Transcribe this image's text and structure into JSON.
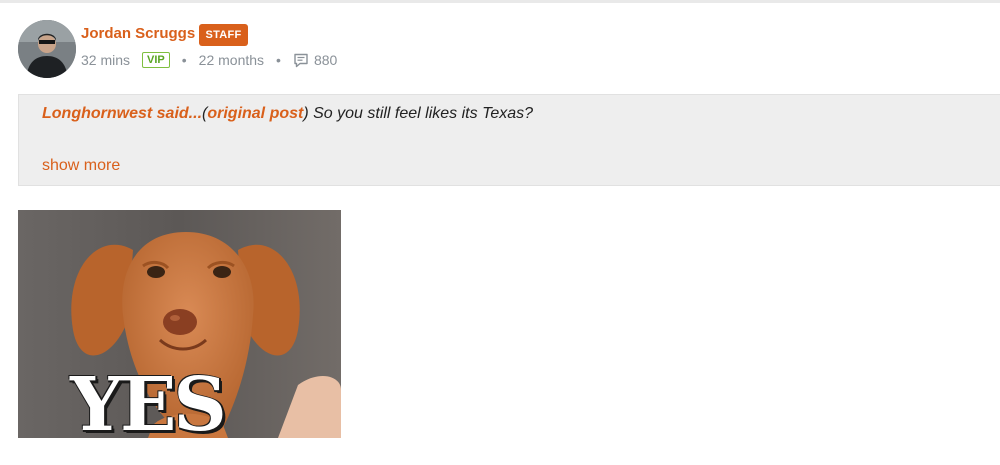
{
  "post": {
    "author": "Jordan Scruggs",
    "role_badge": "STAFF",
    "time_ago": "32 mins",
    "membership_badge": "VIP",
    "member_tenure": "22 months",
    "comment_count": "880",
    "colors": {
      "accent": "#d9601b",
      "vip": "#5aa524",
      "meta": "#8a9198"
    }
  },
  "quote": {
    "author_said": "Longhornwest said...",
    "open_paren": "(",
    "original_link": "original post",
    "close_paren": ")",
    "text": " So you still feel likes its Texas?",
    "show_more": "show more"
  },
  "media": {
    "caption": "YES"
  }
}
